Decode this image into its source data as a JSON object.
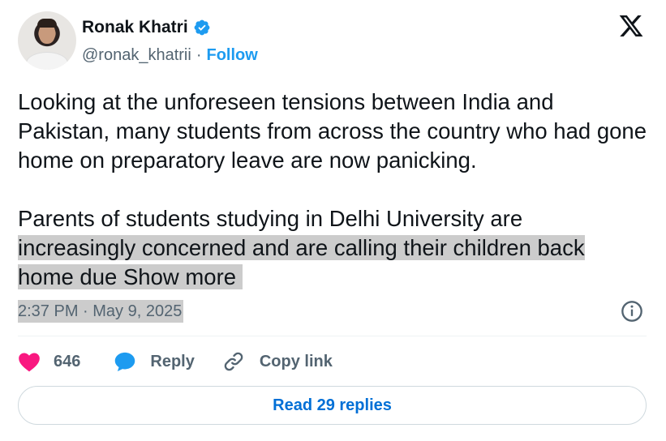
{
  "author": {
    "name": "Ronak Khatri",
    "handle": "@ronak_khatrii",
    "separator": "·",
    "follow_label": "Follow"
  },
  "tweet": {
    "paragraph1": "Looking at the unforeseen tensions between India and Pakistan, many students from across the country who had gone home on preparatory leave are now panicking.",
    "paragraph2_line1": "Parents of students studying in Delhi University are",
    "paragraph2_line2": "increasingly concerned and are calling their children back",
    "paragraph2_line3": "home due ",
    "show_more_label": "Show more",
    "timestamp": "2:37 PM · May 9, 2025"
  },
  "actions": {
    "like_count": "646",
    "reply_label": "Reply",
    "copy_link_label": "Copy link"
  },
  "footer": {
    "read_replies_label": "Read 29 replies"
  },
  "colors": {
    "accent": "#1d9bf0",
    "like": "#f91880",
    "link_button": "#006fd6",
    "highlight": "#cccccc"
  },
  "icons": [
    "verified-badge-icon",
    "x-logo-icon",
    "info-icon",
    "heart-icon",
    "reply-bubble-icon",
    "link-icon"
  ]
}
